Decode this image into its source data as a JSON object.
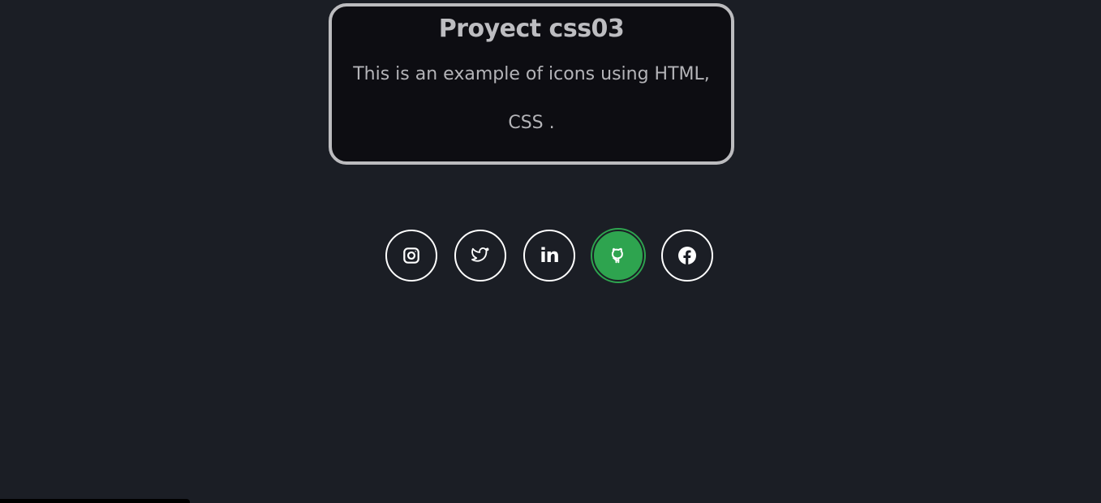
{
  "card": {
    "title": "Proyect css03",
    "description": "This is an example of icons using HTML, CSS ."
  },
  "social": {
    "items": [
      {
        "name": "instagram-icon",
        "active": false
      },
      {
        "name": "twitter-icon",
        "active": false
      },
      {
        "name": "linkedin-icon",
        "label": "in",
        "active": false
      },
      {
        "name": "github-icon",
        "active": true
      },
      {
        "name": "facebook-icon",
        "active": false
      }
    ],
    "colors": {
      "active_bg": "#2ea44f",
      "border": "#ffffff",
      "page_bg": "#1b1e25"
    }
  }
}
